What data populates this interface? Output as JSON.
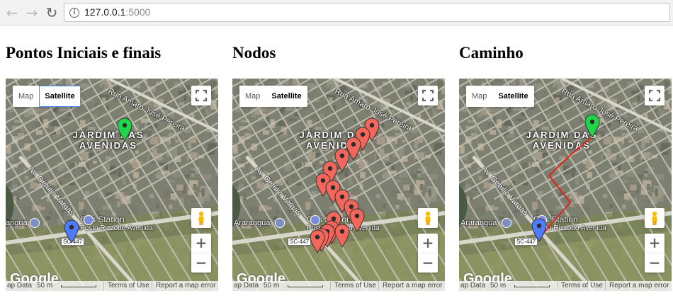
{
  "browser": {
    "url_host": "127.0.0.1",
    "url_port": ":5000"
  },
  "maps": [
    {
      "heading": "Pontos Iniciais e finais",
      "maptype": {
        "map_label": "Map",
        "satellite_label": "Satellite"
      },
      "labels": {
        "area": "JARDIM DAS\nAVENIDAS",
        "street_amaro": "Rua Amaro José Pereira",
        "street_getulio": "Av. Getúlio Vargas",
        "gas_station": "Gas Station",
        "gas_station_sub": "Posto Rizzotto Avenida",
        "city": "anguá",
        "shield": "SC-447"
      },
      "footer": {
        "map_data": "ap Data",
        "scale": "50 m",
        "terms": "Terms of Use",
        "report": "Report a map error"
      },
      "logo": "Google"
    },
    {
      "heading": "Nodos",
      "maptype": {
        "map_label": "Map",
        "satellite_label": "Satellite"
      },
      "labels": {
        "area": "JARDIM DAS\nAVENIDAS",
        "street_amaro": "Rua Amaro José Pereira",
        "street_getulio": "Av. Getúlio Vargas",
        "gas_station": "Gas Station",
        "gas_station_sub": "Posto Rizzotto Avenida",
        "city": "Araranguá",
        "shield": "SC-447"
      },
      "footer": {
        "map_data": "ap Data",
        "scale": "50 m",
        "terms": "Terms of Use",
        "report": "Report a map error"
      },
      "logo": "Google"
    },
    {
      "heading": "Caminho",
      "maptype": {
        "map_label": "Map",
        "satellite_label": "Satellite"
      },
      "labels": {
        "area": "JARDIM DAS\nAVENIDAS",
        "street_amaro": "Rua Amaro José Pereira",
        "street_getulio": "Av. Getúlio Vargas",
        "gas_station": "Gas Station",
        "gas_station_sub": "Posto Rizzotto Avenida",
        "city": "Araranguá",
        "shield": "SC-447"
      },
      "footer": {
        "map_data": "ap Data",
        "scale": "50 m",
        "terms": "Terms of Use",
        "report": "Report a map error"
      },
      "logo": "Google"
    }
  ],
  "colors": {
    "start_marker": "#1fd64a",
    "end_marker": "#4f7bff",
    "node_marker": "#f2665b",
    "path_line": "#e0231b"
  },
  "icons": {
    "back": "arrow-left-icon",
    "forward": "arrow-right-icon",
    "reload": "reload-icon",
    "info": "info-icon",
    "fullscreen": "fullscreen-icon",
    "pegman": "pegman-icon"
  }
}
